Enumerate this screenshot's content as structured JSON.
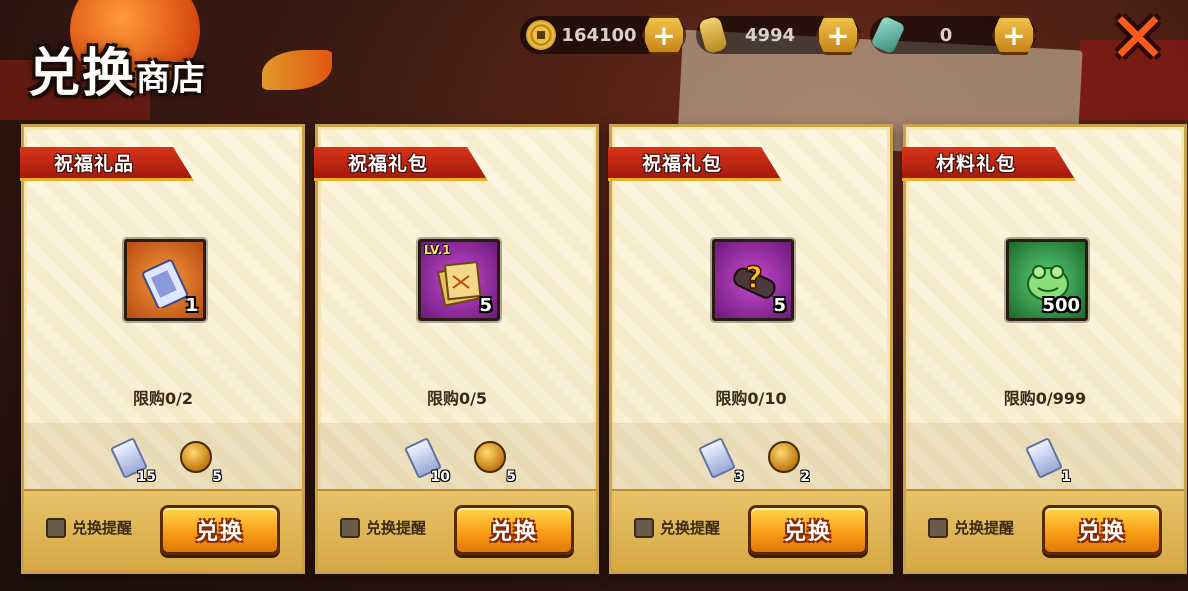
{
  "shop": {
    "title_main": "兑换",
    "title_sub": "商店",
    "close_label": "✕"
  },
  "currencies": [
    {
      "icon": "coin-icon",
      "value": "164100",
      "plus": "+"
    },
    {
      "icon": "gold-stack-icon",
      "value": "4994",
      "plus": "+"
    },
    {
      "icon": "jade-icon",
      "value": "0",
      "plus": "+"
    }
  ],
  "cards": [
    {
      "tag": "祝福礼品",
      "item": {
        "icon": "ticket-scroll-icon",
        "count": "1",
        "level": "",
        "frame_color": "#c8621e"
      },
      "limit": "限购0/2",
      "costs": [
        {
          "type": "ticket",
          "amount": "15"
        },
        {
          "type": "coin",
          "amount": "5"
        }
      ],
      "remind_label": "兑换提醒",
      "button_label": "兑换"
    },
    {
      "tag": "祝福礼包",
      "item": {
        "icon": "scroll-stack-icon",
        "count": "5",
        "level": "LV.1",
        "frame_color": "#8a2a9a"
      },
      "limit": "限购0/5",
      "costs": [
        {
          "type": "ticket",
          "amount": "10"
        },
        {
          "type": "coin",
          "amount": "5"
        }
      ],
      "remind_label": "兑换提醒",
      "button_label": "兑换"
    },
    {
      "tag": "祝福礼包",
      "item": {
        "icon": "mystery-scroll-icon",
        "count": "5",
        "level": "",
        "frame_color": "#8a2a9a"
      },
      "limit": "限购0/10",
      "costs": [
        {
          "type": "ticket",
          "amount": "3"
        },
        {
          "type": "coin",
          "amount": "2"
        }
      ],
      "remind_label": "兑换提醒",
      "button_label": "兑换"
    },
    {
      "tag": "材料礼包",
      "item": {
        "icon": "frog-material-icon",
        "count": "500",
        "level": "",
        "frame_color": "#2a8a3a"
      },
      "limit": "限购0/999",
      "costs": [
        {
          "type": "ticket",
          "amount": "1"
        }
      ],
      "remind_label": "兑换提醒",
      "button_label": "兑换"
    }
  ]
}
